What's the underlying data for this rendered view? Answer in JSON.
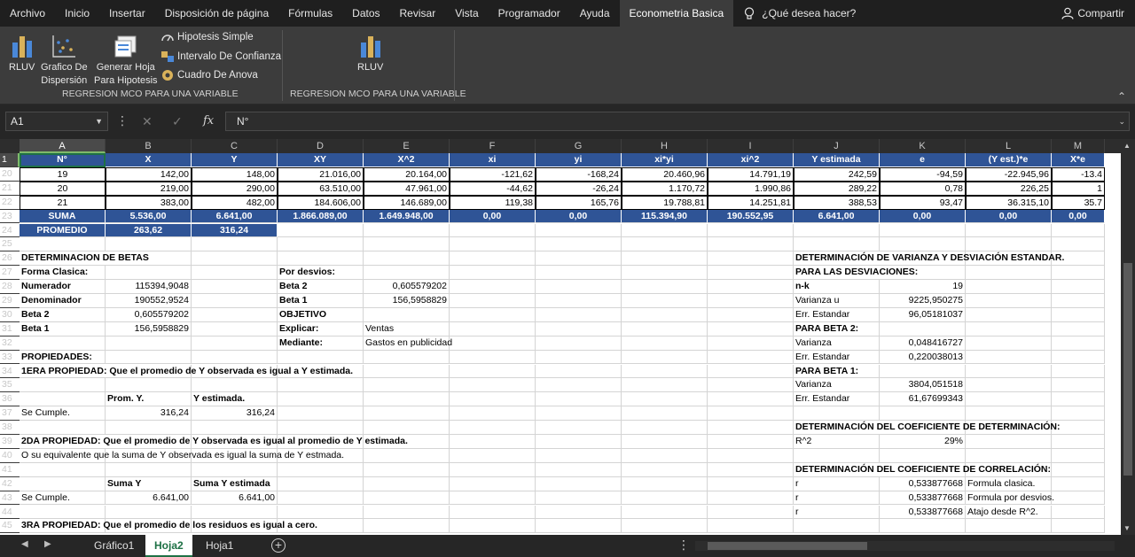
{
  "menu_tabs": [
    "Archivo",
    "Inicio",
    "Insertar",
    "Disposición de página",
    "Fórmulas",
    "Datos",
    "Revisar",
    "Vista",
    "Programador",
    "Ayuda",
    "Econometria Basica"
  ],
  "active_tab_index": 10,
  "tell_me": "¿Qué desea hacer?",
  "share": "Compartir",
  "ribbon": {
    "rluv": "RLUV",
    "grafico": [
      "Grafico De",
      "Dispersión"
    ],
    "generar": [
      "Generar Hoja",
      "Para Hipotesis"
    ],
    "hipotesis_simple": "Hipotesis Simple",
    "intervalo": "Intervalo De Confianza",
    "cuadro": "Cuadro De Anova",
    "rluv2": "RLUV",
    "group1_label": "REGRESION MCO PARA UNA VARIABLE",
    "group2_label": "REGRESION MCO PARA UNA VARIABLE"
  },
  "namebox": "A1",
  "formula": "N°",
  "columns": [
    "A",
    "B",
    "C",
    "D",
    "E",
    "F",
    "G",
    "H",
    "I",
    "J",
    "K",
    "L",
    "M"
  ],
  "rows": [
    "1",
    "20",
    "21",
    "22",
    "23",
    "24",
    "25",
    "26",
    "27",
    "28",
    "29",
    "30",
    "31",
    "32",
    "33",
    "34",
    "35",
    "36",
    "37",
    "38",
    "39",
    "40",
    "41",
    "42",
    "43",
    "44",
    "45"
  ],
  "header_row": [
    "N°",
    "X",
    "Y",
    "XY",
    "X^2",
    "xi",
    "yi",
    "xi*yi",
    "xi^2",
    "Y estimada",
    "e",
    "(Y est.)*e",
    "X*e"
  ],
  "data_rows": [
    [
      "19",
      "142,00",
      "148,00",
      "21.016,00",
      "20.164,00",
      "-121,62",
      "-168,24",
      "20.460,96",
      "14.791,19",
      "242,59",
      "-94,59",
      "-22.945,96",
      "-13.4"
    ],
    [
      "20",
      "219,00",
      "290,00",
      "63.510,00",
      "47.961,00",
      "-44,62",
      "-26,24",
      "1.170,72",
      "1.990,86",
      "289,22",
      "0,78",
      "226,25",
      "1"
    ],
    [
      "21",
      "383,00",
      "482,00",
      "184.606,00",
      "146.689,00",
      "119,38",
      "165,76",
      "19.788,81",
      "14.251,81",
      "388,53",
      "93,47",
      "36.315,10",
      "35.7"
    ]
  ],
  "suma_row": [
    "SUMA",
    "5.536,00",
    "6.641,00",
    "1.866.089,00",
    "1.649.948,00",
    "0,00",
    "0,00",
    "115.394,90",
    "190.552,95",
    "6.641,00",
    "0,00",
    "0,00",
    "0,00"
  ],
  "promedio_row": [
    "PROMEDIO",
    "263,62",
    "316,24"
  ],
  "left": {
    "det_betas": "DETERMINACION DE BETAS",
    "forma_clasica": "Forma Clasica:",
    "numerador": "Numerador",
    "numerador_val": "115394,9048",
    "denominador": "Denominador",
    "denominador_val": "190552,9524",
    "beta2": "Beta 2",
    "beta2_val": "0,605579202",
    "beta1": "Beta 1",
    "beta1_val": "156,5958829",
    "por_desvios": "Por desvios:",
    "d_beta2": "Beta 2",
    "d_beta2_val": "0,605579202",
    "d_beta1": "Beta 1",
    "d_beta1_val": "156,5958829",
    "objetivo": "OBJETIVO",
    "explicar": "Explicar:",
    "explicar_val": "Ventas",
    "mediante": "Mediante:",
    "mediante_val": "Gastos en publicidad",
    "propiedades": "PROPIEDADES:",
    "prop1": "1ERA PROPIEDAD: Que el promedio de Y observada es igual a Y estimada.",
    "prom_y": "Prom. Y.",
    "y_estimada": "Y estimada.",
    "se_cumple1": "Se Cumple.",
    "se_cumple1_b": "316,24",
    "se_cumple1_c": "316,24",
    "prop2": "2DA PROPIEDAD: Que el promedio de Y observada es igual al promedio de Y estimada.",
    "prop2_b": "O su equivalente que la suma de Y observada es igual  la suma de Y estmada.",
    "suma_y": "Suma Y",
    "suma_y_est": "Suma Y estimada",
    "se_cumple2": "Se Cumple.",
    "se_cumple2_b": "6.641,00",
    "se_cumple2_c": "6.641,00",
    "prop3": "3RA PROPIEDAD: Que el promedio de los residuos es igual a cero."
  },
  "right": {
    "det_var": "DETERMINACIÓN DE VARIANZA Y DESVIACIÓN ESTANDAR.",
    "para_desv": "PARA LAS DESVIACIONES:",
    "nk": "n-k",
    "nk_val": "19",
    "var_u": "Varianza u",
    "var_u_val": "9225,950275",
    "err1": "Err. Estandar",
    "err1_val": "96,05181037",
    "para_b2": "PARA BETA 2:",
    "var_b2": "Varianza",
    "var_b2_val": "0,048416727",
    "err_b2": "Err. Estandar",
    "err_b2_val": "0,220038013",
    "para_b1": "PARA BETA 1:",
    "var_b1": "Varianza",
    "var_b1_val": "3804,051518",
    "err_b1": "Err. Estandar",
    "err_b1_val": "61,67699343",
    "det_coef": "DETERMINACIÓN DEL COEFICIENTE DE DETERMINACIÓN:",
    "r2": "R^2",
    "r2_val": "29%",
    "det_corr": "DETERMINACIÓN DEL COEFICIENTE DE CORRELACIÓN:",
    "r_a": "r",
    "r_a_val": "0,533877668",
    "r_a_note": "Formula clasica.",
    "r_b": "r",
    "r_b_val": "0,533877668",
    "r_b_note": "Formula por desvios.",
    "r_c": "r",
    "r_c_val": "0,533877668",
    "r_c_note": "Atajo desde R^2."
  },
  "sheets": [
    "Gráfico1",
    "Hoja2",
    "Hoja1"
  ],
  "active_sheet_index": 1,
  "colors": {
    "accent_green": "#1e7145",
    "header_blue": "#2f5496",
    "dark_bg": "#1f1f1f"
  }
}
